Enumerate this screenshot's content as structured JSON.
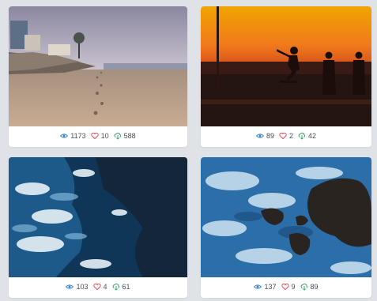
{
  "cards": [
    {
      "id": "beach",
      "views": "1173",
      "likes": "10",
      "downloads": "588"
    },
    {
      "id": "skate",
      "views": "89",
      "likes": "2",
      "downloads": "42"
    },
    {
      "id": "waves-1",
      "views": "103",
      "likes": "4",
      "downloads": "61"
    },
    {
      "id": "waves-2",
      "views": "137",
      "likes": "9",
      "downloads": "89"
    }
  ],
  "icons": {
    "views": "eye-icon",
    "likes": "heart-icon",
    "downloads": "cloud-download-icon"
  },
  "colors": {
    "background": "#dfe3e8",
    "card": "#ffffff",
    "eye": "#3a8ac9",
    "heart": "#e0495c",
    "download": "#3aa86f",
    "text": "#4a4f57"
  }
}
